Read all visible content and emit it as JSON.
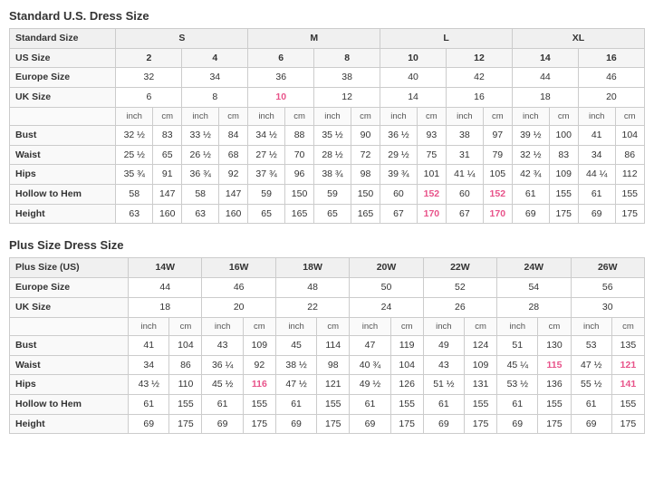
{
  "standard": {
    "title": "Standard U.S. Dress Size",
    "sizeGroups": [
      {
        "label": "Standard Size",
        "cols": [
          "S",
          "",
          "M",
          "",
          "L",
          "",
          "XL",
          ""
        ]
      },
      {
        "label": "US Size",
        "cols": [
          "2",
          "4",
          "6",
          "8",
          "10",
          "12",
          "14",
          "16"
        ]
      },
      {
        "label": "Europe Size",
        "cols": [
          "32",
          "34",
          "36",
          "38",
          "40",
          "42",
          "44",
          "46"
        ]
      },
      {
        "label": "UK Size",
        "cols": [
          "6",
          "8",
          "10",
          "12",
          "14",
          "16",
          "18",
          "20"
        ]
      }
    ],
    "unitRow": [
      "inch",
      "cm",
      "inch",
      "cm",
      "inch",
      "cm",
      "inch",
      "cm",
      "inch",
      "cm",
      "inch",
      "cm",
      "inch",
      "cm",
      "inch",
      "cm"
    ],
    "measurements": [
      {
        "label": "Bust",
        "vals": [
          "32 ½",
          "83",
          "33 ½",
          "84",
          "34 ½",
          "88",
          "35 ½",
          "90",
          "36 ½",
          "93",
          "38",
          "97",
          "39 ½",
          "100",
          "41",
          "104"
        ]
      },
      {
        "label": "Waist",
        "vals": [
          "25 ½",
          "65",
          "26 ½",
          "68",
          "27 ½",
          "70",
          "28 ½",
          "72",
          "29 ½",
          "75",
          "31",
          "79",
          "32 ½",
          "83",
          "34",
          "86"
        ]
      },
      {
        "label": "Hips",
        "vals": [
          "35 ¾",
          "91",
          "36 ¾",
          "92",
          "37 ¾",
          "96",
          "38 ¾",
          "98",
          "39 ¾",
          "101",
          "41 ¼",
          "105",
          "42 ¾",
          "109",
          "44 ¼",
          "112"
        ]
      },
      {
        "label": "Hollow to Hem",
        "vals": [
          "58",
          "147",
          "58",
          "147",
          "59",
          "150",
          "59",
          "150",
          "60",
          "152",
          "60",
          "152",
          "61",
          "155",
          "61",
          "155"
        ]
      },
      {
        "label": "Height",
        "vals": [
          "63",
          "160",
          "63",
          "160",
          "65",
          "165",
          "65",
          "165",
          "67",
          "170",
          "67",
          "170",
          "69",
          "175",
          "69",
          "175"
        ]
      }
    ],
    "pinkCols": {
      "ukSize": [
        2
      ],
      "hollowToHem": [
        5,
        11
      ],
      "height": [
        5,
        11
      ]
    }
  },
  "plus": {
    "title": "Plus Size Dress Size",
    "sizeGroups": [
      {
        "label": "Plus Size (US)",
        "cols": [
          "14W",
          "16W",
          "18W",
          "20W",
          "22W",
          "24W",
          "26W"
        ]
      },
      {
        "label": "Europe Size",
        "cols": [
          "44",
          "46",
          "48",
          "50",
          "52",
          "54",
          "56"
        ]
      },
      {
        "label": "UK Size",
        "cols": [
          "18",
          "20",
          "22",
          "24",
          "26",
          "28",
          "30"
        ]
      }
    ],
    "unitRow": [
      "inch",
      "cm",
      "inch",
      "cm",
      "inch",
      "cm",
      "inch",
      "cm",
      "inch",
      "cm",
      "inch",
      "cm",
      "inch",
      "cm"
    ],
    "measurements": [
      {
        "label": "Bust",
        "vals": [
          "41",
          "104",
          "43",
          "109",
          "45",
          "114",
          "47",
          "119",
          "49",
          "124",
          "51",
          "130",
          "53",
          "135"
        ]
      },
      {
        "label": "Waist",
        "vals": [
          "34",
          "86",
          "36 ¼",
          "92",
          "38 ½",
          "98",
          "40 ¾",
          "104",
          "43",
          "109",
          "45 ¼",
          "115",
          "47 ½",
          "121"
        ]
      },
      {
        "label": "Hips",
        "vals": [
          "43 ½",
          "110",
          "45 ½",
          "116",
          "47 ½",
          "121",
          "49 ½",
          "126",
          "51 ½",
          "131",
          "53 ½",
          "136",
          "55 ½",
          "141"
        ]
      },
      {
        "label": "Hollow to Hem",
        "vals": [
          "61",
          "155",
          "61",
          "155",
          "61",
          "155",
          "61",
          "155",
          "61",
          "155",
          "61",
          "155",
          "61",
          "155"
        ]
      },
      {
        "label": "Height",
        "vals": [
          "69",
          "175",
          "69",
          "175",
          "69",
          "175",
          "69",
          "175",
          "69",
          "175",
          "69",
          "175",
          "69",
          "175"
        ]
      }
    ],
    "pinkCols": {
      "waist": [
        5,
        13
      ],
      "hips": [
        3,
        13
      ]
    }
  }
}
